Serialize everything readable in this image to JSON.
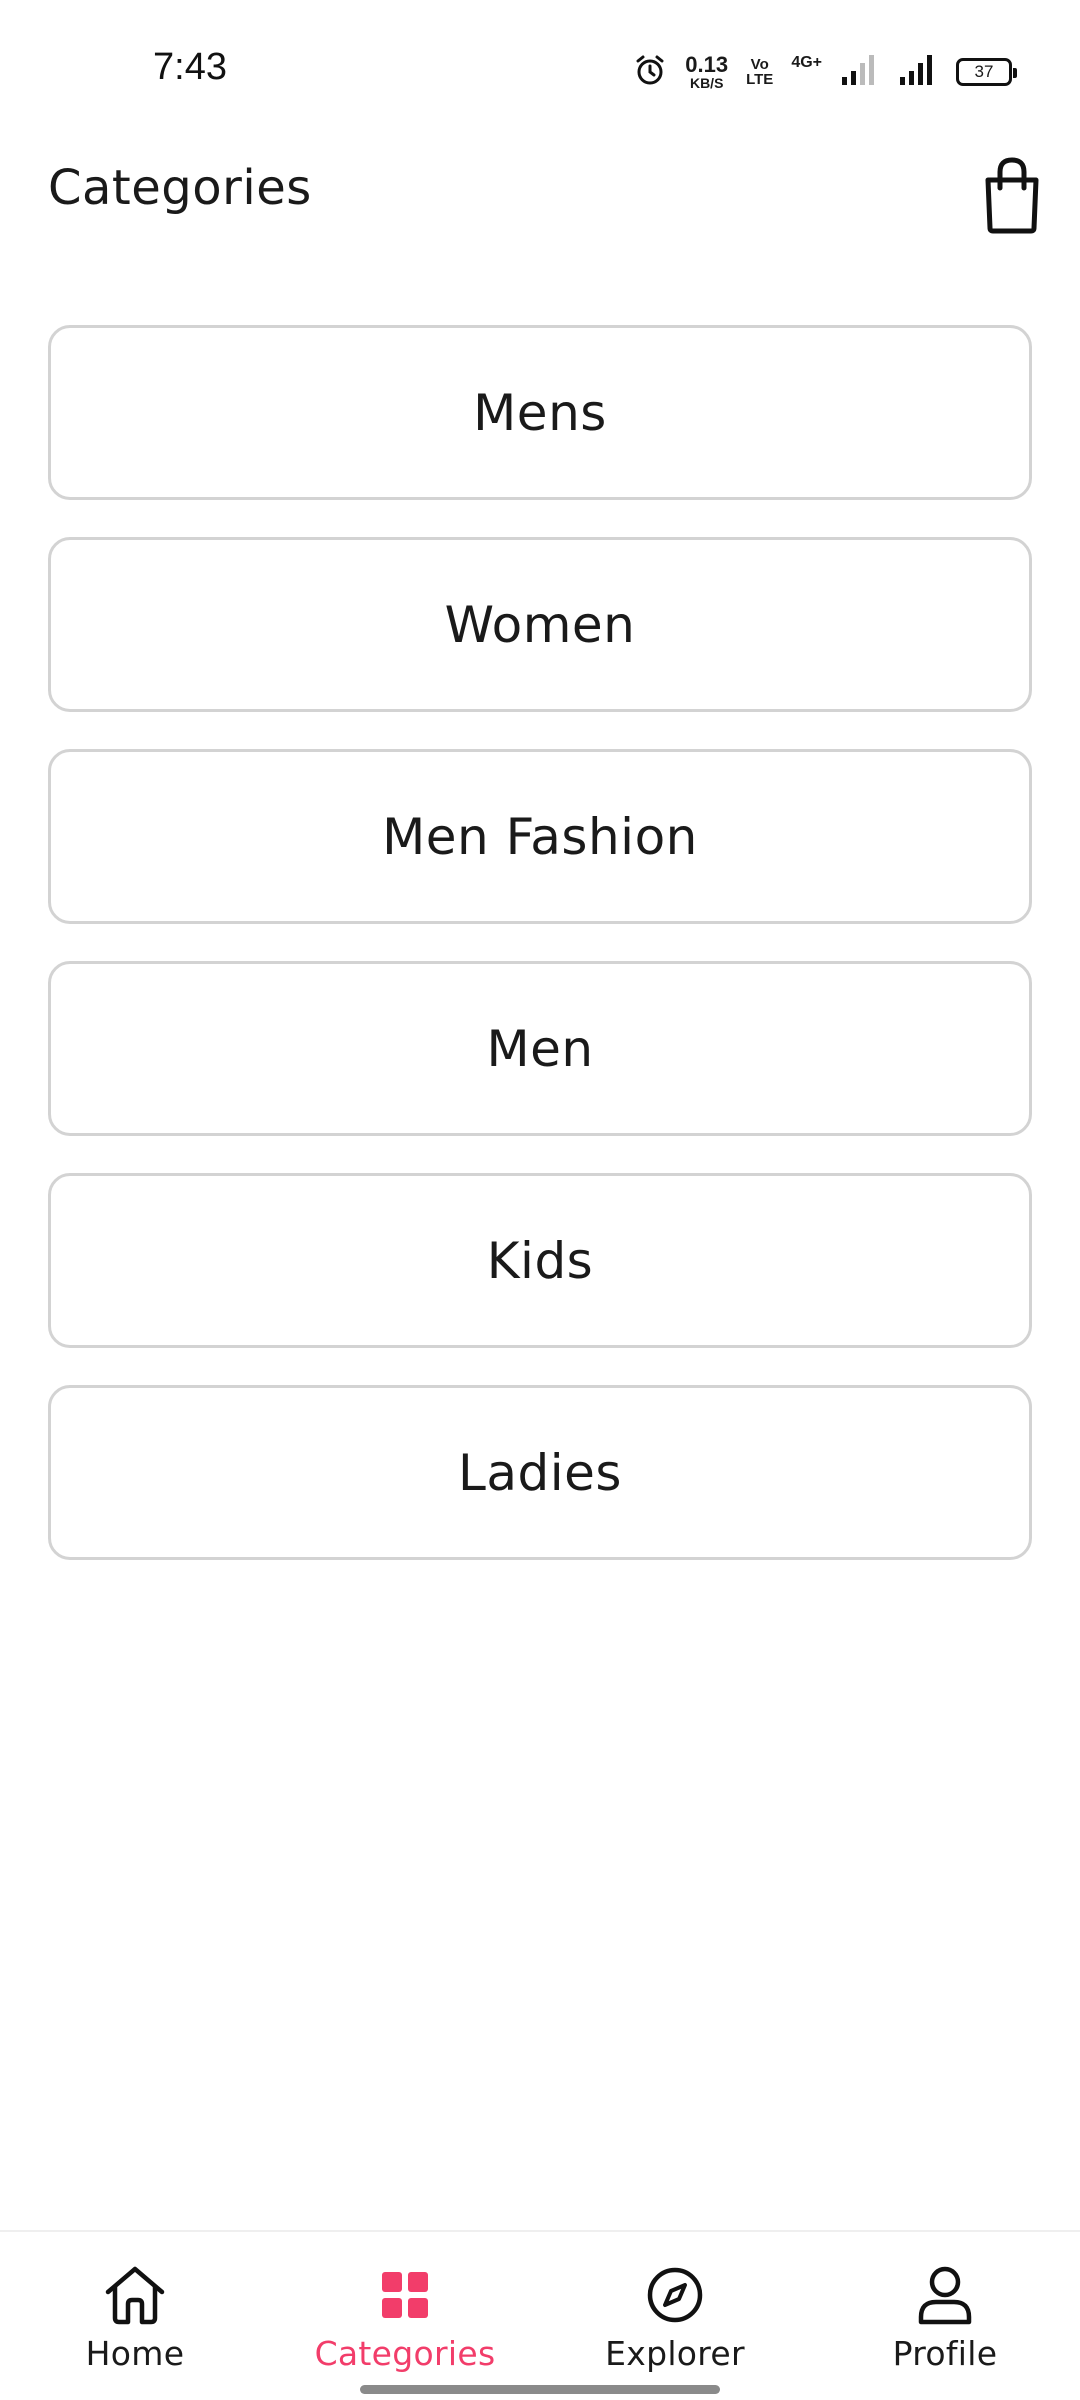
{
  "status_bar": {
    "time": "7:43",
    "net_speed_value": "0.13",
    "net_speed_unit": "KB/S",
    "volte_top": "Vo",
    "volte_bottom": "LTE",
    "network_type": "4G+",
    "battery": "37",
    "icons": [
      "alarm-icon",
      "signal-icon",
      "signal-icon",
      "battery-icon"
    ]
  },
  "header": {
    "title": "Categories",
    "cart_icon": "shopping-bag-icon"
  },
  "categories": [
    {
      "label": "Mens"
    },
    {
      "label": "Women"
    },
    {
      "label": "Men Fashion"
    },
    {
      "label": "Men"
    },
    {
      "label": "Kids"
    },
    {
      "label": "Ladies"
    }
  ],
  "bottom_nav": {
    "active_color": "#f23d6a",
    "items": [
      {
        "label": "Home",
        "icon": "home-icon",
        "active": false
      },
      {
        "label": "Categories",
        "icon": "grid-icon",
        "active": true
      },
      {
        "label": "Explorer",
        "icon": "compass-icon",
        "active": false
      },
      {
        "label": "Profile",
        "icon": "user-icon",
        "active": false
      }
    ]
  }
}
